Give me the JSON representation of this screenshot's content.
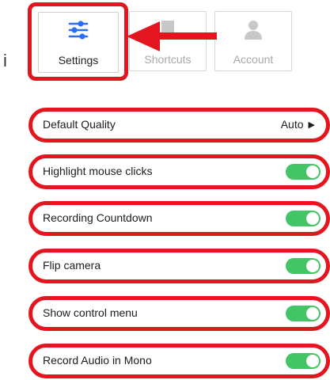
{
  "stray_glyph": "i",
  "tabs": [
    {
      "label": "Settings",
      "icon": "sliders-icon",
      "active": true
    },
    {
      "label": "Shortcuts",
      "icon": "bookmark-icon",
      "active": false
    },
    {
      "label": "Account",
      "icon": "user-icon",
      "active": false
    }
  ],
  "settings": {
    "default_quality": {
      "label": "Default Quality",
      "value": "Auto"
    },
    "highlight_clicks": {
      "label": "Highlight mouse clicks",
      "enabled": true
    },
    "recording_countdown": {
      "label": "Recording Countdown",
      "enabled": true
    },
    "flip_camera": {
      "label": "Flip camera",
      "enabled": true
    },
    "show_control_menu": {
      "label": "Show control menu",
      "enabled": true
    },
    "record_audio_mono": {
      "label": "Record Audio in Mono",
      "enabled": true
    }
  },
  "colors": {
    "highlight": "#e3151f",
    "toggle_on": "#43c466",
    "accent_icon": "#2b6df6",
    "muted": "#a8a8a8"
  }
}
